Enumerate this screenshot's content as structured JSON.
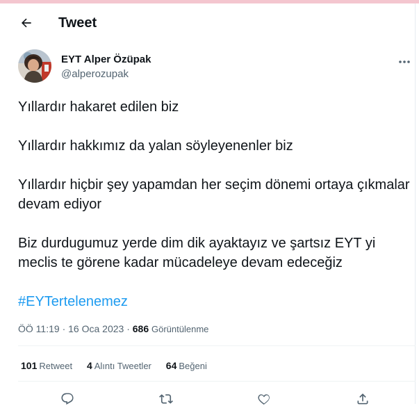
{
  "header": {
    "title": "Tweet",
    "back_icon": "arrow-left-icon"
  },
  "author": {
    "name": "EYT Alper Özüpak",
    "handle": "@alperozupak",
    "more_icon": "more-horizontal-icon"
  },
  "tweet": {
    "paragraphs": [
      "Yıllardır hakaret edilen biz",
      "Yıllardır hakkımız da yalan söyleyenenler biz",
      "Yıllardır hiçbir şey yapamdan her seçim dönemi ortaya çıkmalar devam ediyor",
      "Biz durdugumuz yerde dim dik ayaktayız ve şartsız EYT yi meclis te görene kadar mücadeleye devam edeceğiz"
    ],
    "hashtag": "#EYTertelenemez"
  },
  "meta": {
    "time": "ÖÖ 11:19",
    "separator": "·",
    "date": "16 Oca 2023",
    "views_count": "686",
    "views_label": "Görüntülenme"
  },
  "stats": {
    "retweets_count": "101",
    "retweets_label": "Retweet",
    "quotes_count": "4",
    "quotes_label": "Alıntı Tweetler",
    "likes_count": "64",
    "likes_label": "Beğeni"
  },
  "actions": [
    "reply-icon",
    "retweet-icon",
    "like-icon",
    "share-icon"
  ],
  "colors": {
    "accent": "#1d9bf0",
    "text": "#0f1419",
    "secondary_text": "#536471",
    "divider": "#eff3f4"
  }
}
